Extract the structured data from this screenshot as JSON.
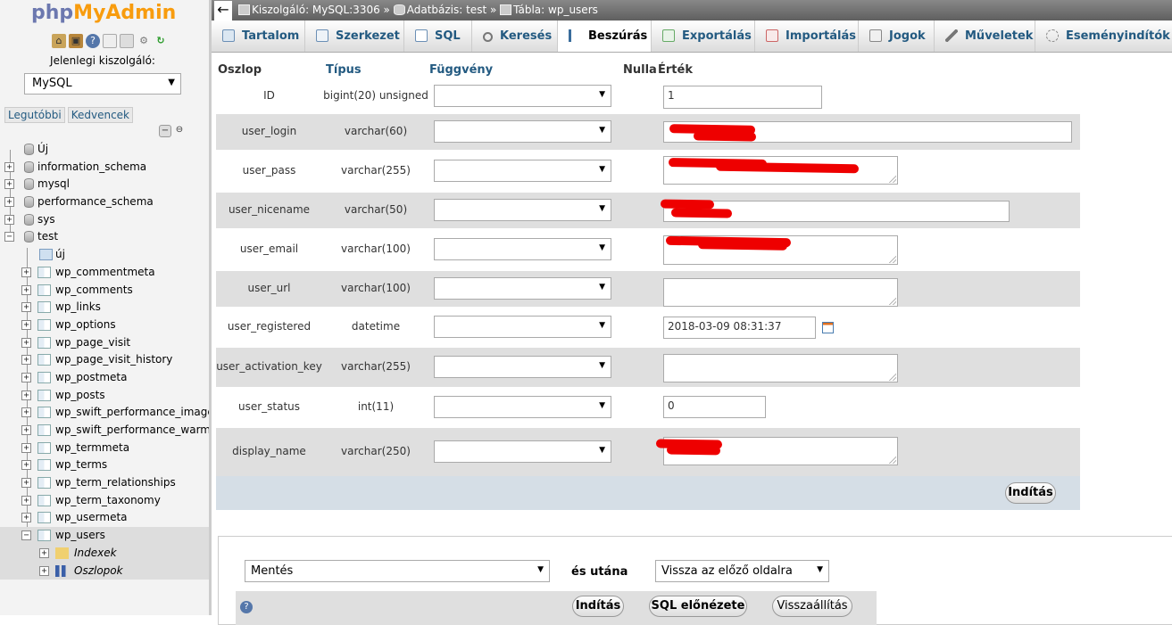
{
  "app": {
    "logo_part1": "php",
    "logo_part2": "MyAdmin"
  },
  "left": {
    "server_label": "Jelenlegi kiszolgáló:",
    "server_select": "MySQL",
    "tab_recent": "Legutóbbi",
    "tab_favorites": "Kedvencek",
    "tree_new": "Új",
    "databases": [
      "information_schema",
      "mysql",
      "performance_schema",
      "sys",
      "test"
    ],
    "test_new": "új",
    "tables": [
      "wp_commentmeta",
      "wp_comments",
      "wp_links",
      "wp_options",
      "wp_page_visit",
      "wp_page_visit_history",
      "wp_postmeta",
      "wp_posts",
      "wp_swift_performance_image_",
      "wp_swift_performance_warmu",
      "wp_termmeta",
      "wp_terms",
      "wp_term_relationships",
      "wp_term_taxonomy",
      "wp_usermeta",
      "wp_users"
    ],
    "wp_users_children": [
      "Indexek",
      "Oszlopok"
    ]
  },
  "breadcrumb": {
    "server": "Kiszolgáló: MySQL:3306",
    "sep": "»",
    "database": "Adatbázis: test",
    "table": "Tábla: wp_users"
  },
  "menu": [
    "Tartalom",
    "Szerkezet",
    "SQL",
    "Keresés",
    "Beszúrás",
    "Exportálás",
    "Importálás",
    "Jogok",
    "Műveletek",
    "Eseményindítók"
  ],
  "insert": {
    "headers": {
      "column": "Oszlop",
      "type": "Típus",
      "function": "Függvény",
      "null": "Nulla",
      "value": "Érték"
    },
    "rows": [
      {
        "name": "ID",
        "type": "bigint(20) unsigned",
        "value": "1"
      },
      {
        "name": "user_login",
        "type": "varchar(60)",
        "value": ""
      },
      {
        "name": "user_pass",
        "type": "varchar(255)",
        "value": ""
      },
      {
        "name": "user_nicename",
        "type": "varchar(50)",
        "value": ""
      },
      {
        "name": "user_email",
        "type": "varchar(100)",
        "value": ""
      },
      {
        "name": "user_url",
        "type": "varchar(100)",
        "value": ""
      },
      {
        "name": "user_registered",
        "type": "datetime",
        "value": "2018-03-09 08:31:37"
      },
      {
        "name": "user_activation_key",
        "type": "varchar(255)",
        "value": ""
      },
      {
        "name": "user_status",
        "type": "int(11)",
        "value": "0"
      },
      {
        "name": "display_name",
        "type": "varchar(250)",
        "value": ""
      }
    ],
    "go_button": "Indítás"
  },
  "bottom": {
    "action_select": "Mentés",
    "and_then": "és utána",
    "after_select": "Vissza az előző oldalra",
    "go_button": "Indítás",
    "sql_preview_button": "SQL előnézete",
    "reset_button": "Visszaállítás"
  }
}
